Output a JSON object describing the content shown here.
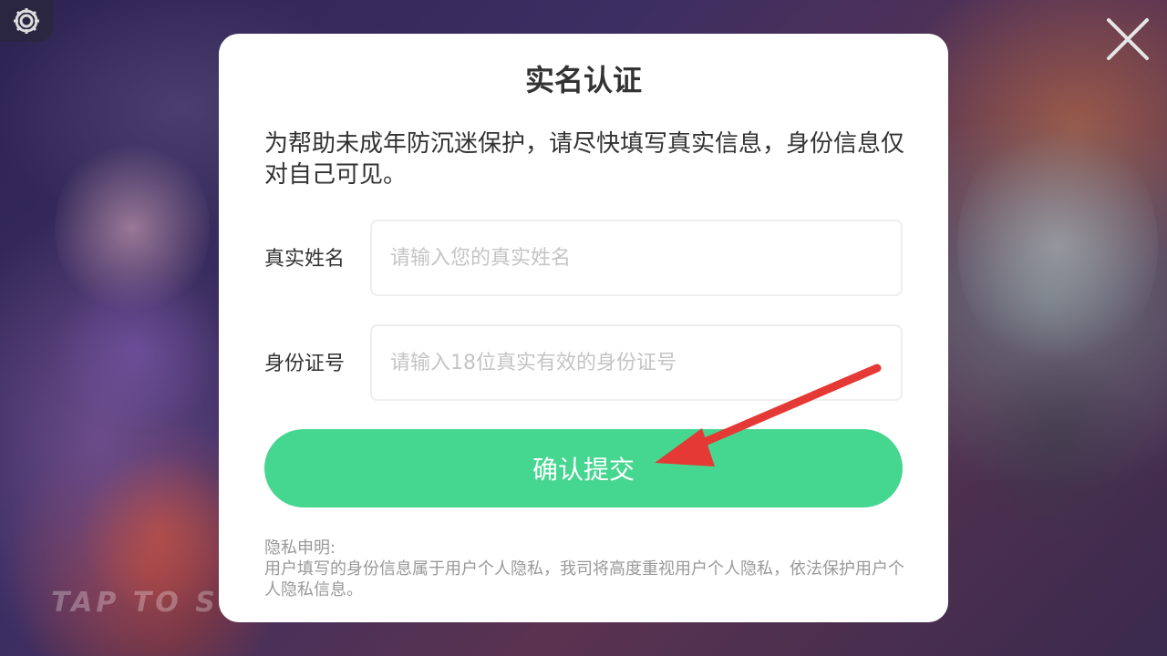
{
  "modal": {
    "title": "实名认证",
    "intro": "为帮助未成年防沉迷保护，请尽快填写真实信息，身份信息仅对自己可见。",
    "name_field": {
      "label": "真实姓名",
      "value": "",
      "placeholder": "请输入您的真实姓名"
    },
    "id_field": {
      "label": "身份证号",
      "value": "",
      "placeholder": "请输入18位真实有效的身份证号"
    },
    "submit_label": "确认提交",
    "privacy": {
      "heading": "隐私申明:",
      "body": "用户填写的身份信息属于用户个人隐私，我司将高度重视用户个人隐私，依法保护用户个人隐私信息。"
    }
  },
  "background": {
    "tap_text": "TAP TO S"
  },
  "icons": {
    "settings": "gear-icon",
    "close": "close-icon",
    "annotation": "red-arrow-icon"
  },
  "colors": {
    "accent": "#45d690",
    "arrow": "#e53935",
    "modal_bg": "#ffffff"
  }
}
